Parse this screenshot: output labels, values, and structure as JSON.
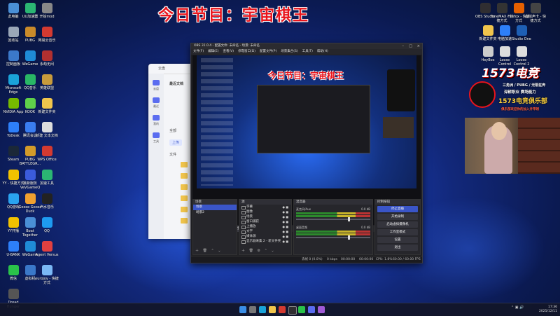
{
  "banner": {
    "text": "今日节目：宇宙棋王"
  },
  "desktop_icons_left": [
    {
      "label": "此电脑",
      "color": "#4a8fd6"
    },
    {
      "label": "UU加速器",
      "color": "#2bb673"
    },
    {
      "label": "开始mod",
      "color": "#888888"
    },
    {
      "label": "回收站",
      "color": "#9aa7b8"
    },
    {
      "label": "PUBG",
      "color": "#c98a2a"
    },
    {
      "label": "网易云音乐",
      "color": "#d33a31"
    },
    {
      "label": "控制面板",
      "color": "#3b78c9"
    },
    {
      "label": "WeGame",
      "color": "#1f8bd6"
    },
    {
      "label": "永劫无间",
      "color": "#b03030"
    },
    {
      "label": "Microsoft Edge",
      "color": "#1aa3d9"
    },
    {
      "label": "QQ音乐",
      "color": "#29b765"
    },
    {
      "label": "英雄联盟",
      "color": "#c89b3c"
    },
    {
      "label": "NVIDIA App",
      "color": "#76b900"
    },
    {
      "label": "KOOK",
      "color": "#5fd04a"
    },
    {
      "label": "新建文件夹",
      "color": "#f1c54c"
    },
    {
      "label": "ToDesk",
      "color": "#2d7ff9"
    },
    {
      "label": "腾讯会议",
      "color": "#3a7df0"
    },
    {
      "label": "新建 文本文档",
      "color": "#dddddd"
    },
    {
      "label": "Steam",
      "color": "#1b2838"
    },
    {
      "label": "PUBG BATTLEGR...",
      "color": "#d39b2a"
    },
    {
      "label": "WPS Office",
      "color": "#d33a31"
    },
    {
      "label": "YY - 快捷方式",
      "color": "#f2c200"
    },
    {
      "label": "最新服务 VeVGameQ",
      "color": "#3b5bdb"
    },
    {
      "label": "加速工具",
      "color": "#2bb673"
    },
    {
      "label": "QQ游戏",
      "color": "#2aa3ef"
    },
    {
      "label": "Goose Goose Duck",
      "color": "#f0a030"
    },
    {
      "label": "汽水音乐",
      "color": "#222222"
    },
    {
      "label": "YY开播",
      "color": "#f2c200"
    },
    {
      "label": "Boat Together",
      "color": "#4a8fd6"
    },
    {
      "label": "QQ",
      "color": "#1e9bf0"
    },
    {
      "label": "U-BANK",
      "color": "#2d7ff9"
    },
    {
      "label": "WeGame",
      "color": "#1f8bd6"
    },
    {
      "label": "Agent Versus",
      "color": "#e04040"
    },
    {
      "label": "微信",
      "color": "#2ac24a"
    },
    {
      "label": "虚拟机",
      "color": "#3a78c9"
    },
    {
      "label": "eurojoy - 快捷方式",
      "color": "#7ab8f5"
    },
    {
      "label": "Dread Hunger",
      "color": "#555555"
    }
  ],
  "desktop_icons_right": [
    {
      "label": "OBS Studio",
      "color": "#302e31"
    },
    {
      "label": "ToneMAX - 快捷方式",
      "color": "#333333"
    },
    {
      "label": "Firefox - 快捷方式",
      "color": "#e66000"
    },
    {
      "label": "虚拟声卡 - 快捷方式",
      "color": "#444444"
    },
    {
      "label": "新建文件夹",
      "color": "#f1c54c"
    },
    {
      "label": "电脑加速",
      "color": "#2d7ff9"
    },
    {
      "label": "Studio One",
      "color": "#1e5fb4"
    },
    {
      "label": "HeyBox",
      "color": "#cccccc"
    },
    {
      "label": "Loose Control",
      "color": "#dddddd"
    },
    {
      "label": "Loose Control 2",
      "color": "#dddddd"
    }
  ],
  "file_manager": {
    "title": "云盘",
    "heading": "最近文档",
    "tabs": [
      "全部",
      "上传",
      "文件"
    ],
    "side_items": [
      "云盘",
      "最近",
      "我的",
      "工具"
    ]
  },
  "obs": {
    "title": "OBS 31.0.4 - 配置文件: 未命名 - 场景: 未命名",
    "menu": [
      "文件(F)",
      "编辑(E)",
      "查看(V)",
      "停靠窗口(D)",
      "配置文件(P)",
      "场景集合(S)",
      "工具(T)",
      "帮助(H)"
    ],
    "preview_banner": "今日节目：宇宙棋王",
    "source_bar_label": "未选择源",
    "source_bar_buttons": [
      "属性",
      "滤镜"
    ],
    "scenes_header": "场景",
    "scenes": [
      {
        "name": "场景",
        "selected": true
      },
      {
        "name": "场景2",
        "selected": false
      }
    ],
    "sources_header": "源",
    "sources": [
      "字幕",
      "图像",
      "场景",
      "窗口捕获",
      "上播放",
      "文字",
      "媒体源",
      "显示器采集 2 - 新文件夹"
    ],
    "mixer_header": "混音器",
    "mixer": [
      {
        "name": "麦克风/Aux",
        "level": "0.0 dB"
      },
      {
        "name": "桌面音频",
        "level": "0.0 dB"
      }
    ],
    "controls_header": "控制按钮",
    "controls": [
      "停止直播",
      "开始录制",
      "启动虚拟摄像机",
      "工作室模式",
      "设置",
      "退出"
    ],
    "status": {
      "dropped": "丢帧 0 (0.0%)",
      "bitrate": "0 kbps",
      "stream_time": "00:00:00",
      "rec_time": "00:00:00",
      "cpu": "CPU: 1.8%",
      "fps": "60.00 / 60.00 FPS"
    }
  },
  "overlay": {
    "logo": "1573电竞",
    "line1": "三角洲 / PUBG / 无限狂奔",
    "line2": "深耕职业   赛场能力",
    "line3": "1573电竞俱乐部",
    "line4": "俱乐部欢迎你的加入并带领"
  },
  "taskbar": {
    "time": "17:36",
    "date": "2025/12/11"
  }
}
